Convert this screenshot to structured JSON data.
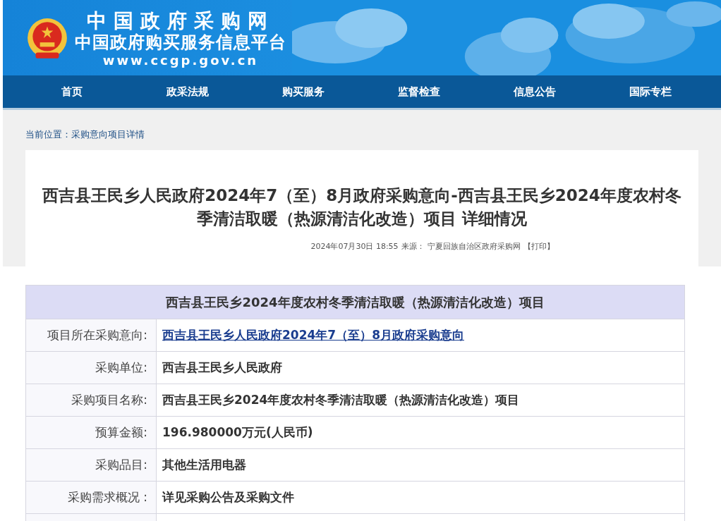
{
  "header": {
    "site_name": "中国政府采购网",
    "subtitle": "中国政府购买服务信息平台",
    "url": "www.ccgp.gov.cn"
  },
  "nav": [
    {
      "label": "首页"
    },
    {
      "label": "政采法规"
    },
    {
      "label": "购买服务"
    },
    {
      "label": "监督检查"
    },
    {
      "label": "信息公告"
    },
    {
      "label": "国际专栏"
    }
  ],
  "breadcrumb": {
    "label": "当前位置：",
    "path": "采购意向项目详情"
  },
  "article": {
    "title": "西吉县王民乡人民政府2024年7（至）8月政府采购意向-西吉县王民乡2024年度农村冬季清洁取暖（热源清洁化改造）项目 详细情况",
    "date": "2024年07月30日 18:55",
    "source_label": "来源：",
    "source": "宁夏回族自治区政府采购网",
    "print": "【打印】"
  },
  "table": {
    "caption": "西吉县王民乡2024年度农村冬季清洁取暖（热源清洁化改造）项目",
    "rows": [
      {
        "label": "项目所在采购意向:",
        "value": "西吉县王民乡人民政府2024年7（至）8月政府采购意向",
        "kind": "link"
      },
      {
        "label": "采购单位:",
        "value": "西吉县王民乡人民政府",
        "kind": "text"
      },
      {
        "label": "采购项目名称:",
        "value": "西吉县王民乡2024年度农村冬季清洁取暖（热源清洁化改造）项目",
        "kind": "text"
      },
      {
        "label": "预算金额:",
        "value": "196.980000万元(人民币)",
        "kind": "text"
      },
      {
        "label": "采购品目:",
        "value": "其他生活用电器",
        "kind": "text"
      },
      {
        "label": "采购需求概况 :",
        "value": "详见采购公告及采购文件",
        "kind": "text"
      }
    ]
  }
}
